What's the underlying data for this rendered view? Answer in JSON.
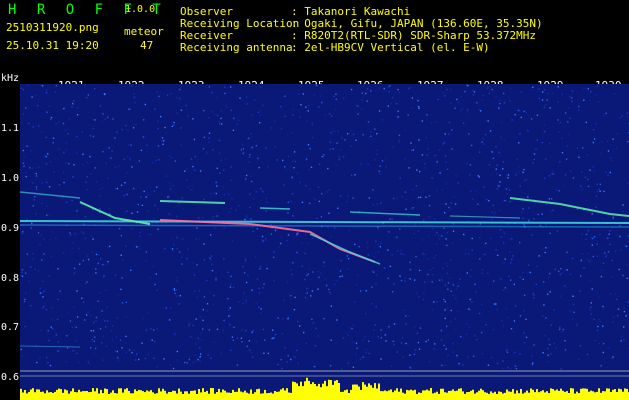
{
  "header": {
    "brand": "H R O F F T",
    "version": "1.0.0",
    "file_name": "2510311920.png",
    "meteor_label": "meteor",
    "datetime": "25.10.31 19:20",
    "meteor_count": "47"
  },
  "info": [
    {
      "label": "Observer",
      "value": ": Takanori Kawachi"
    },
    {
      "label": "Receiving Location",
      "value": ": Ogaki, Gifu, JAPAN (136.60E, 35.35N)"
    },
    {
      "label": "Receiver",
      "value": ": R820T2(RTL-SDR) SDR-Sharp 53.372MHz"
    },
    {
      "label": "Receiving antenna",
      "value": ": 2el-HB9CV Vertical (el. E-W)"
    }
  ],
  "axes": {
    "freq_unit": "kHz",
    "time_ticks": [
      "1921",
      "1922",
      "1923",
      "1924",
      "1925",
      "1926",
      "1927",
      "1928",
      "1929",
      "1930"
    ],
    "freq_ticks": [
      "1.1",
      "1.0",
      "0.9",
      "0.8",
      "0.7",
      "0.6"
    ]
  },
  "colors": {
    "background": "#000000",
    "spectrogram_base": "#0a1878",
    "header_green": "#00ff00",
    "header_yellow": "#ffff00",
    "tick_white": "#ffffff",
    "signal_cyan": "#40e0e0",
    "level_yellow": "#ffff00"
  }
}
